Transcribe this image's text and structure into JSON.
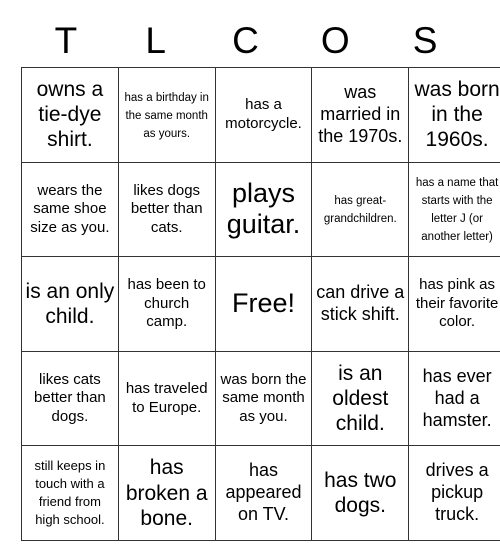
{
  "card": {
    "header_letters": [
      "T",
      "L",
      "C",
      "O",
      "S"
    ],
    "free_space_label": "Free!",
    "rows": [
      [
        {
          "text": "owns a tie-dye shirt.",
          "size": "t-xl"
        },
        {
          "text": "has a birthday in the same month as yours.",
          "size": "t-xs"
        },
        {
          "text": "has a motorcycle.",
          "size": "t-md"
        },
        {
          "text": "was married in the 1970s.",
          "size": "t-lg"
        },
        {
          "text": "was born in the 1960s.",
          "size": "t-xl"
        }
      ],
      [
        {
          "text": "wears the same shoe size as you.",
          "size": "t-md"
        },
        {
          "text": "likes dogs better than cats.",
          "size": "t-md"
        },
        {
          "text": "plays guitar.",
          "size": "t-xxl"
        },
        {
          "text": "has great-grandchildren.",
          "size": "t-xs"
        },
        {
          "text": "has a name that starts with the letter J (or another letter)",
          "size": "t-xs"
        }
      ],
      [
        {
          "text": "is an only child.",
          "size": "t-xl"
        },
        {
          "text": "has been to church camp.",
          "size": "t-md"
        },
        {
          "text": "Free!",
          "size": "t-xxl"
        },
        {
          "text": "can drive a stick shift.",
          "size": "t-lg"
        },
        {
          "text": "has pink as their favorite color.",
          "size": "t-md"
        }
      ],
      [
        {
          "text": "likes cats better than dogs.",
          "size": "t-md"
        },
        {
          "text": "has traveled to Europe.",
          "size": "t-md"
        },
        {
          "text": "was born the same month as you.",
          "size": "t-md"
        },
        {
          "text": "is an oldest child.",
          "size": "t-xl"
        },
        {
          "text": "has ever had a hamster.",
          "size": "t-lg"
        }
      ],
      [
        {
          "text": "still keeps in touch with a friend from high school.",
          "size": "t-sm"
        },
        {
          "text": "has broken a bone.",
          "size": "t-xl"
        },
        {
          "text": "has appeared on TV.",
          "size": "t-lg"
        },
        {
          "text": "has two dogs.",
          "size": "t-xl"
        },
        {
          "text": "drives a pickup truck.",
          "size": "t-lg"
        }
      ]
    ]
  }
}
